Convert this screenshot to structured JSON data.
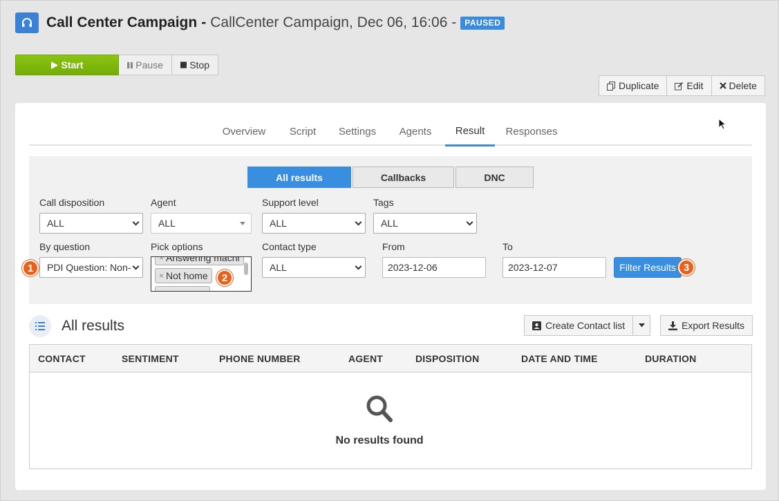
{
  "header": {
    "title": "Call Center Campaign",
    "separator": "-",
    "subtitle": "CallCenter Campaign, Dec 06, 16:06 -",
    "status_badge": "PAUSED",
    "app_icon": "headset-icon"
  },
  "controls": {
    "start_label": "Start",
    "pause_label": "Pause",
    "stop_label": "Stop"
  },
  "actions": {
    "duplicate_label": "Duplicate",
    "edit_label": "Edit",
    "delete_label": "Delete"
  },
  "tabs": [
    {
      "label": "Overview"
    },
    {
      "label": "Script"
    },
    {
      "label": "Settings"
    },
    {
      "label": "Agents"
    },
    {
      "label": "Result",
      "active": true
    },
    {
      "label": "Responses"
    }
  ],
  "result_types": [
    {
      "label": "All results",
      "active": true
    },
    {
      "label": "Callbacks"
    },
    {
      "label": "DNC"
    }
  ],
  "filters": {
    "call_disposition": {
      "label": "Call disposition",
      "value": "ALL"
    },
    "agent": {
      "label": "Agent",
      "value": "ALL"
    },
    "support_level": {
      "label": "Support level",
      "value": "ALL"
    },
    "tags": {
      "label": "Tags",
      "value": "ALL"
    },
    "by_question": {
      "label": "By question",
      "value": "PDI Question: Non-"
    },
    "pick_options": {
      "label": "Pick options",
      "chips": [
        "Answering machi",
        "Not home"
      ]
    },
    "contact_type": {
      "label": "Contact type",
      "value": "ALL"
    },
    "from": {
      "label": "From",
      "value": "2023-12-06"
    },
    "to": {
      "label": "To",
      "value": "2023-12-07"
    },
    "filter_button": "Filter Results"
  },
  "markers": [
    "1",
    "2",
    "3"
  ],
  "results": {
    "title": "All results",
    "create_contact_list_label": "Create Contact list",
    "export_label": "Export Results",
    "columns": [
      "CONTACT",
      "SENTIMENT",
      "PHONE NUMBER",
      "AGENT",
      "DISPOSITION",
      "DATE AND TIME",
      "DURATION"
    ],
    "empty_message": "No results found"
  },
  "colors": {
    "accent": "#3a8ee0",
    "start_green": "#7ab80b",
    "marker_orange": "#e8611a"
  }
}
